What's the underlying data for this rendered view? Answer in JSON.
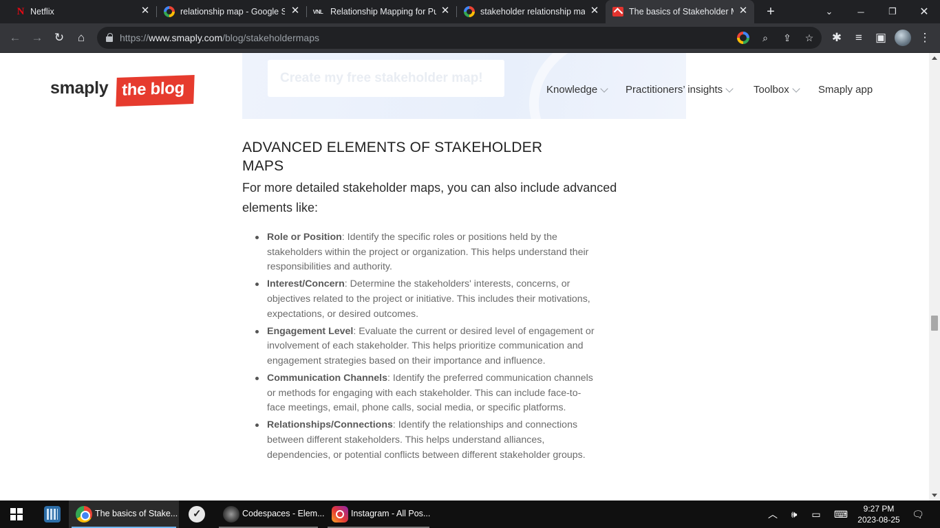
{
  "browser": {
    "tabs": [
      {
        "title": "Netflix",
        "favicon": "netflix-icon",
        "active": false
      },
      {
        "title": "relationship map - Google Se",
        "favicon": "google-icon",
        "active": false
      },
      {
        "title": "Relationship Mapping for Pul",
        "favicon": "vnl-icon",
        "favicon_text": "VNL",
        "active": false
      },
      {
        "title": "stakeholder relationship map",
        "favicon": "google-icon",
        "active": false
      },
      {
        "title": "The basics of Stakeholder Ma",
        "favicon": "smaply-icon",
        "active": true
      }
    ],
    "url_prefix": "https://",
    "url_domain": "www.smaply.com",
    "url_path": "/blog/stakeholdermaps"
  },
  "page": {
    "cta_button": "Create my free stakeholder map!",
    "logo_word": "smaply",
    "logo_badge": "the blog",
    "nav": [
      {
        "label": "Knowledge",
        "has_dropdown": true
      },
      {
        "label": "Practitioners’ insights",
        "has_dropdown": true
      },
      {
        "label": "Toolbox",
        "has_dropdown": true
      },
      {
        "label": "Smaply app",
        "has_dropdown": false
      }
    ],
    "heading": "ADVANCED ELEMENTS OF STAKEHOLDER MAPS",
    "intro": "For more detailed stakeholder maps, you can also include advanced elements like:",
    "items": [
      {
        "term": "Role or Position",
        "text": ": Identify the specific roles or positions held by the stakeholders within the project or organization. This helps understand their responsibilities and authority."
      },
      {
        "term": "Interest/Concern",
        "text": ": Determine the stakeholders' interests, concerns, or objectives related to the project or initiative. This includes their motivations, expectations, or desired outcomes."
      },
      {
        "term": "Engagement Level",
        "text": ": Evaluate the current or desired level of engagement or involvement of each stakeholder. This helps prioritize communication and engagement strategies based on their importance and influence."
      },
      {
        "term": "Communication Channels",
        "text": ": Identify the preferred communication channels or methods for engaging with each stakeholder. This can include face-to-face meetings, email, phone calls, social media, or specific platforms."
      },
      {
        "term": "Relationships/Connections",
        "text": ": Identify the relationships and connections between different stakeholders. This helps understand alliances, dependencies, or potential conflicts between different stakeholder groups."
      }
    ]
  },
  "taskbar": {
    "apps": [
      {
        "label": "The basics of Stake...",
        "icon": "chrome-icon"
      },
      {
        "label": "Codespaces - Elem...",
        "icon": "app-icon"
      },
      {
        "label": "Instagram - All Pos...",
        "icon": "instagram-icon"
      }
    ],
    "time": "9:27 PM",
    "date": "2023-08-25"
  },
  "colors": {
    "brand_red": "#e63b2e",
    "chrome_dark": "#202124",
    "chrome_toolbar": "#35363a",
    "taskbar": "#101010"
  }
}
